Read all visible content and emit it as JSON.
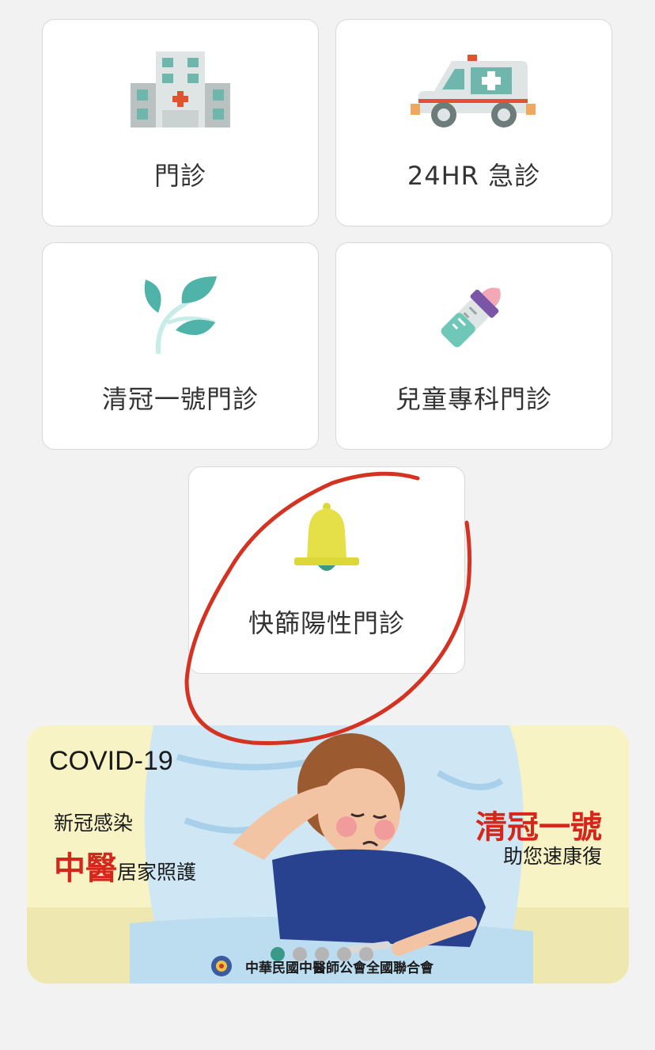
{
  "menu": {
    "outpatient": "門診",
    "emergency": "24HR 急診",
    "qingguan": "清冠一號門診",
    "pediatric": "兒童專科門診",
    "rapid_positive": "快篩陽性門診"
  },
  "icons": {
    "outpatient": "hospital-icon",
    "emergency": "ambulance-icon",
    "qingguan": "herb-leaf-icon",
    "pediatric": "baby-bottle-icon",
    "rapid_positive": "bell-icon"
  },
  "banner": {
    "heading": "COVID-19",
    "line1": "新冠感染",
    "line2_big": "中醫",
    "line2_small": "居家照護",
    "right_big": "清冠一號",
    "right_small": "助您速康復",
    "organization": "中華民國中醫師公會全國聯合會",
    "slide_count": 5,
    "active_slide": 1
  },
  "colors": {
    "accent_red": "#d6261c",
    "teal": "#4fb3a9",
    "annotation_red": "#d43322"
  }
}
